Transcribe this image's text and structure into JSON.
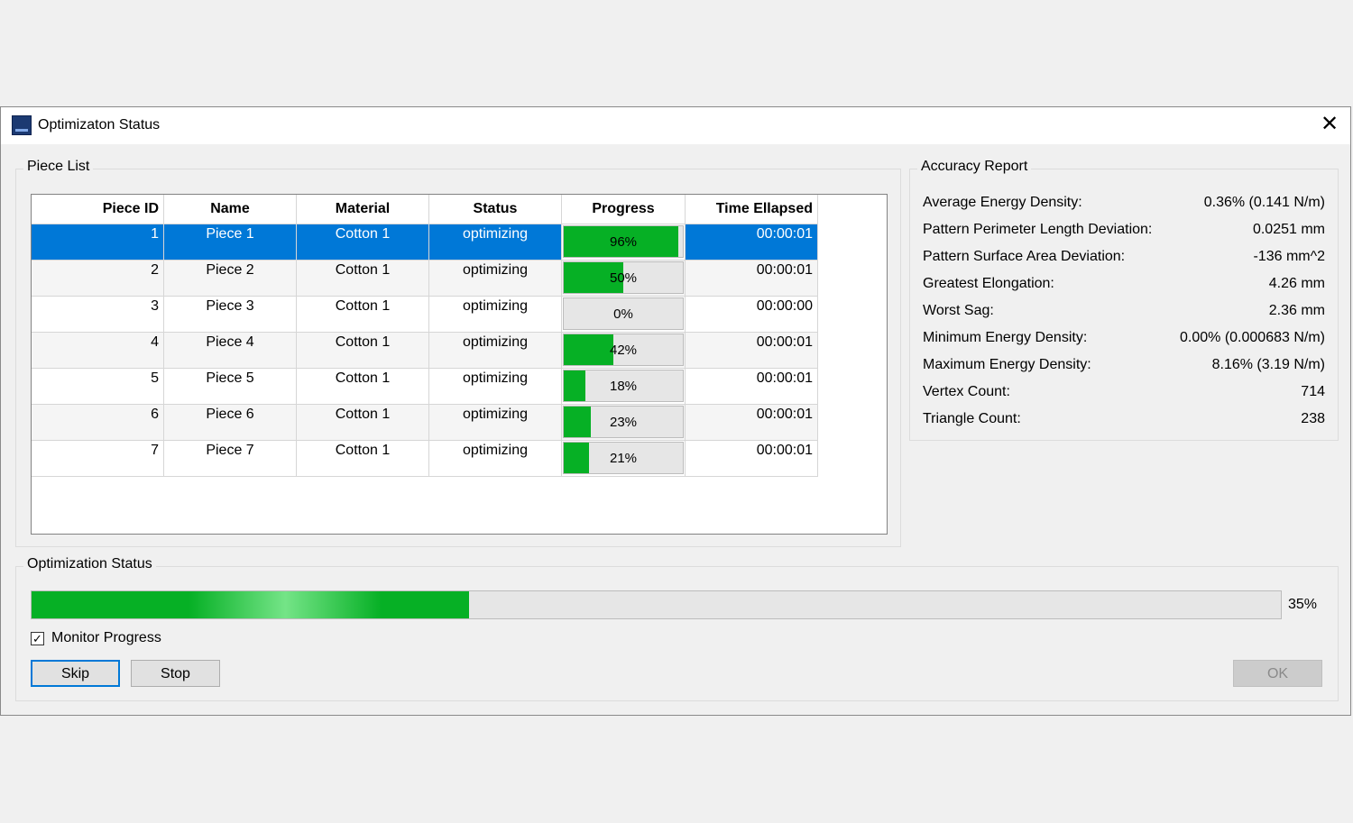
{
  "window": {
    "title": "Optimizaton Status",
    "close_glyph": "✕"
  },
  "piece_list": {
    "label": "Piece List",
    "columns": [
      "Piece ID",
      "Name",
      "Material",
      "Status",
      "Progress",
      "Time Ellapsed"
    ],
    "rows": [
      {
        "id": "1",
        "name": "Piece 1",
        "material": "Cotton 1",
        "status": "optimizing",
        "progress": 96,
        "progress_label": "96%",
        "time": "00:00:01"
      },
      {
        "id": "2",
        "name": "Piece 2",
        "material": "Cotton 1",
        "status": "optimizing",
        "progress": 50,
        "progress_label": "50%",
        "time": "00:00:01"
      },
      {
        "id": "3",
        "name": "Piece 3",
        "material": "Cotton 1",
        "status": "optimizing",
        "progress": 0,
        "progress_label": "0%",
        "time": "00:00:00"
      },
      {
        "id": "4",
        "name": "Piece 4",
        "material": "Cotton 1",
        "status": "optimizing",
        "progress": 42,
        "progress_label": "42%",
        "time": "00:00:01"
      },
      {
        "id": "5",
        "name": "Piece 5",
        "material": "Cotton 1",
        "status": "optimizing",
        "progress": 18,
        "progress_label": "18%",
        "time": "00:00:01"
      },
      {
        "id": "6",
        "name": "Piece 6",
        "material": "Cotton 1",
        "status": "optimizing",
        "progress": 23,
        "progress_label": "23%",
        "time": "00:00:01"
      },
      {
        "id": "7",
        "name": "Piece 7",
        "material": "Cotton 1",
        "status": "optimizing",
        "progress": 21,
        "progress_label": "21%",
        "time": "00:00:01"
      }
    ]
  },
  "accuracy": {
    "label": "Accuracy Report",
    "rows": [
      {
        "label": "Average Energy Density:",
        "value": "0.36% (0.141 N/m)"
      },
      {
        "label": "Pattern Perimeter Length Deviation:",
        "value": "0.0251 mm"
      },
      {
        "label": "Pattern Surface Area Deviation:",
        "value": "-136 mm^2"
      },
      {
        "label": "Greatest Elongation:",
        "value": "4.26 mm"
      },
      {
        "label": "Worst Sag:",
        "value": "2.36 mm"
      },
      {
        "label": "Minimum Energy Density:",
        "value": "0.00% (0.000683 N/m)"
      },
      {
        "label": "Maximum Energy Density:",
        "value": "8.16% (3.19 N/m)"
      },
      {
        "label": "Vertex Count:",
        "value": "714"
      },
      {
        "label": "Triangle Count:",
        "value": "238"
      }
    ]
  },
  "status": {
    "label": "Optimization Status",
    "progress": 35,
    "progress_label": "35%",
    "monitor_label": "Monitor Progress",
    "check_glyph": "✓",
    "skip_label": "Skip",
    "stop_label": "Stop",
    "ok_label": "OK"
  },
  "colors": {
    "accent": "#0078d7",
    "progress_green": "#06b025"
  }
}
